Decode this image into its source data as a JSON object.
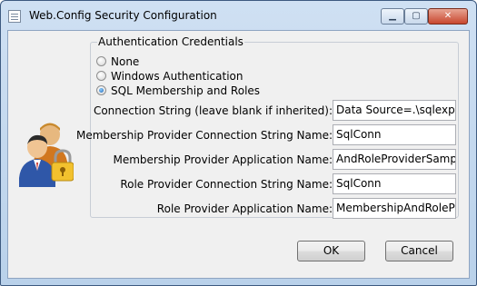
{
  "window": {
    "title": "Web.Config Security Configuration"
  },
  "title_controls": {
    "minimize": "▁",
    "maximize": "▢",
    "close": "✕"
  },
  "group": {
    "legend": "Authentication Credentials",
    "options": [
      {
        "label": "None",
        "checked": false
      },
      {
        "label": "Windows Authentication",
        "checked": false
      },
      {
        "label": "SQL Membership and Roles",
        "checked": true
      }
    ]
  },
  "fields": {
    "connection_string": {
      "label": "Connection String (leave blank if inherited):",
      "value": "Data Source=.\\sqlexpres"
    },
    "membership_conn": {
      "label": "Membership Provider Connection String Name:",
      "value": "SqlConn"
    },
    "membership_app": {
      "label": "Membership Provider Application Name:",
      "value": "AndRoleProviderSample"
    },
    "role_conn": {
      "label": "Role Provider Connection String Name:",
      "value": "SqlConn"
    },
    "role_app": {
      "label": "Role Provider Application Name:",
      "value": "MembershipAndRolePro"
    }
  },
  "buttons": {
    "ok": "OK",
    "cancel": "Cancel"
  },
  "icons": {
    "app": "document-icon",
    "security": "users-lock-icon"
  }
}
